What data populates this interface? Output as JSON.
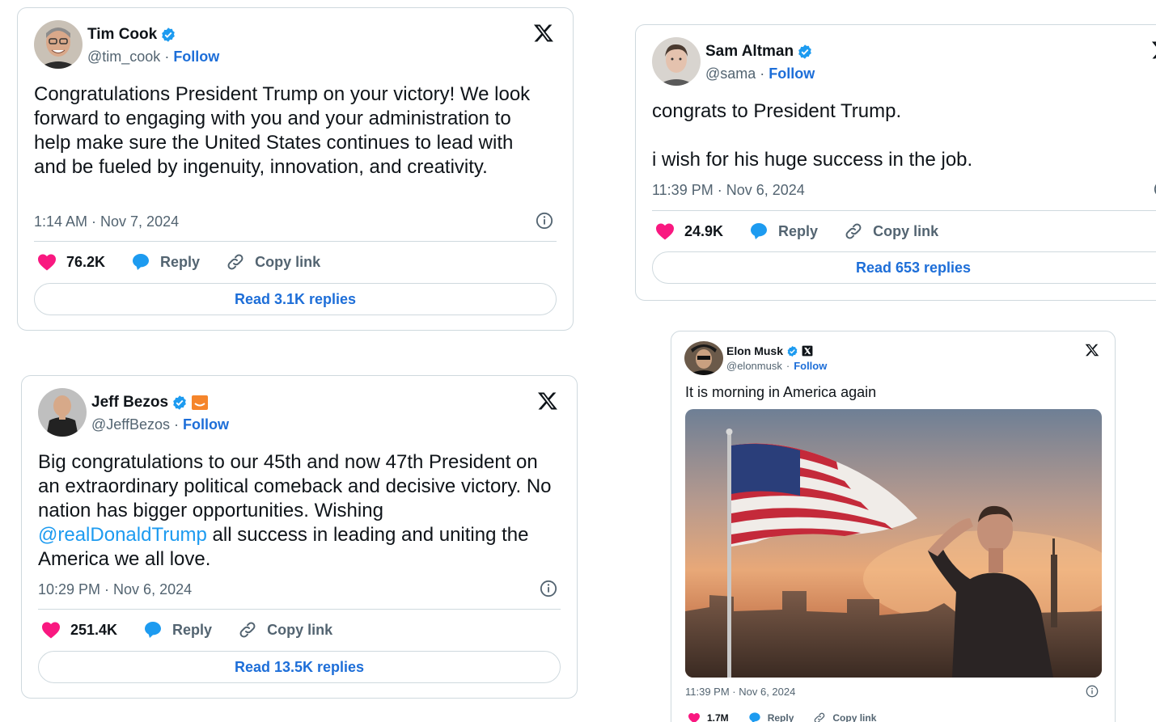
{
  "tweets": {
    "cook": {
      "name": "Tim Cook",
      "handle": "@tim_cook",
      "sep": "·",
      "follow": "Follow",
      "text": "Congratulations President Trump on your victory!  We look forward to engaging with you and your administration to help make sure the United States continues to lead with and be fueled by ingenuity, innovation, and creativity.",
      "time": "1:14 AM · Nov 7, 2024",
      "likes": "76.2K",
      "reply": "Reply",
      "copy": "Copy link",
      "read": "Read 3.1K replies"
    },
    "altman": {
      "name": "Sam Altman",
      "handle": "@sama",
      "sep": "·",
      "follow": "Follow",
      "text_line1": "congrats to President Trump.",
      "text_line2": "i wish for his huge success in the job.",
      "time": "11:39 PM · Nov 6, 2024",
      "likes": "24.9K",
      "reply": "Reply",
      "copy": "Copy link",
      "read": "Read 653 replies"
    },
    "bezos": {
      "name": "Jeff Bezos",
      "handle": "@JeffBezos",
      "sep": "·",
      "follow": "Follow",
      "text_before": "Big congratulations to our 45th and now 47th President on an extraordinary political comeback and decisive victory. No nation has bigger opportunities. Wishing ",
      "mention": "@realDonaldTrump",
      "text_after": " all success in leading and uniting the America we all love.",
      "time": "10:29 PM · Nov 6, 2024",
      "likes": "251.4K",
      "reply": "Reply",
      "copy": "Copy link",
      "read": "Read 13.5K replies"
    },
    "musk": {
      "name": "Elon Musk",
      "handle": "@elonmusk",
      "sep": "·",
      "follow": "Follow",
      "text": "It is morning in America again",
      "time": "11:39 PM · Nov 6, 2024",
      "likes": "1.7M",
      "reply": "Reply",
      "copy": "Copy link"
    }
  },
  "colors": {
    "link": "#1d6ed8",
    "verified": "#1d9bf0",
    "like": "#f91880",
    "reply": "#1d9bf0",
    "muted": "#536471",
    "border": "#cfd9de"
  }
}
